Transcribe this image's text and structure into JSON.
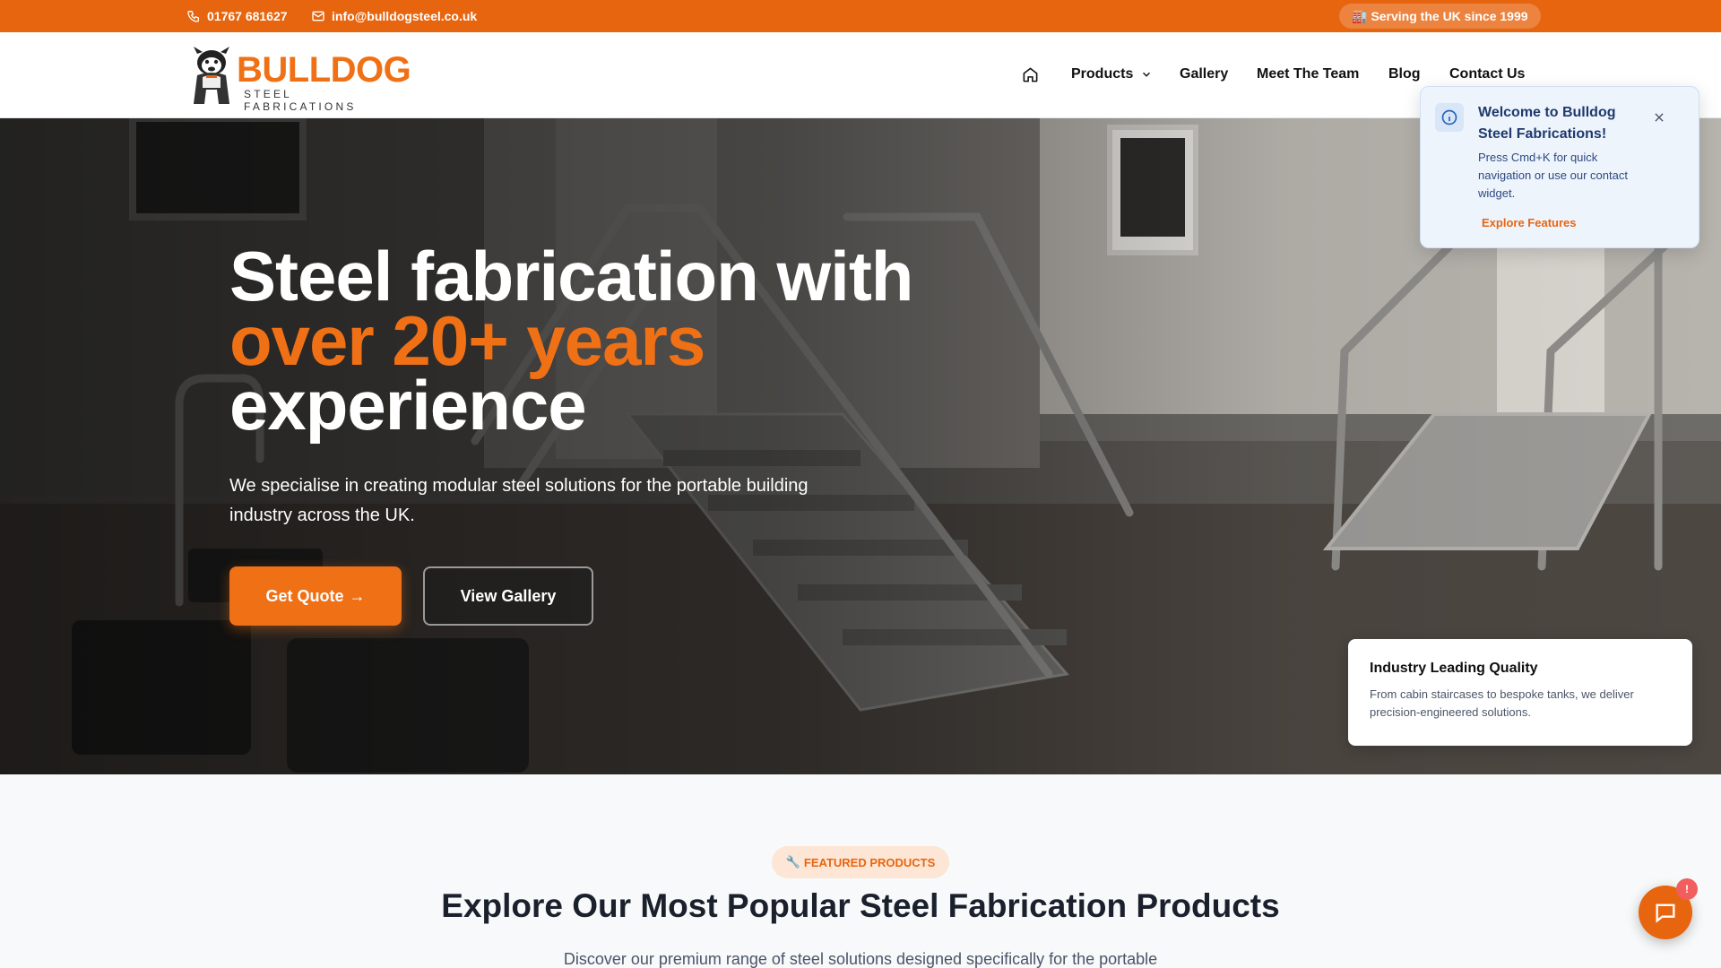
{
  "topbar": {
    "phone": "01767 681627",
    "email": "info@bulldogsteel.co.uk",
    "since_icon": "🏭",
    "since_text": "Serving the UK since 1999"
  },
  "header": {
    "logo_word": "BULLDOG",
    "logo_sub": "STEEL FABRICATIONS",
    "nav": {
      "home_icon": "home-icon",
      "products": "Products",
      "gallery": "Gallery",
      "team": "Meet The Team",
      "blog": "Blog",
      "contact": "Contact Us"
    }
  },
  "hero": {
    "title_line1": "Steel fabrication with",
    "title_line2": "over 20+ years",
    "title_line3": "experience",
    "subtitle": "We specialise in creating modular steel solutions for the portable building industry across the UK.",
    "btn_quote": "Get Quote",
    "btn_quote_arrow": "→",
    "btn_gallery": "View Gallery",
    "card_title": "Industry Leading Quality",
    "card_text": "From cabin staircases to bespoke tanks, we deliver precision-engineered solutions."
  },
  "toast": {
    "title": "Welcome to Bulldog Steel Fabrications!",
    "body": "Press Cmd+K for quick navigation or use our contact widget.",
    "link": "Explore Features"
  },
  "featured": {
    "badge_icon": "🔧",
    "badge": "FEATURED PRODUCTS",
    "title": "Explore Our Most Popular Steel Fabrication Products",
    "desc": "Discover our premium range of steel solutions designed specifically for the portable"
  },
  "chat": {
    "badge": "!"
  },
  "colors": {
    "accent": "#e8650f",
    "accent_bright": "#f07016",
    "info_bg": "#eef4fc"
  }
}
